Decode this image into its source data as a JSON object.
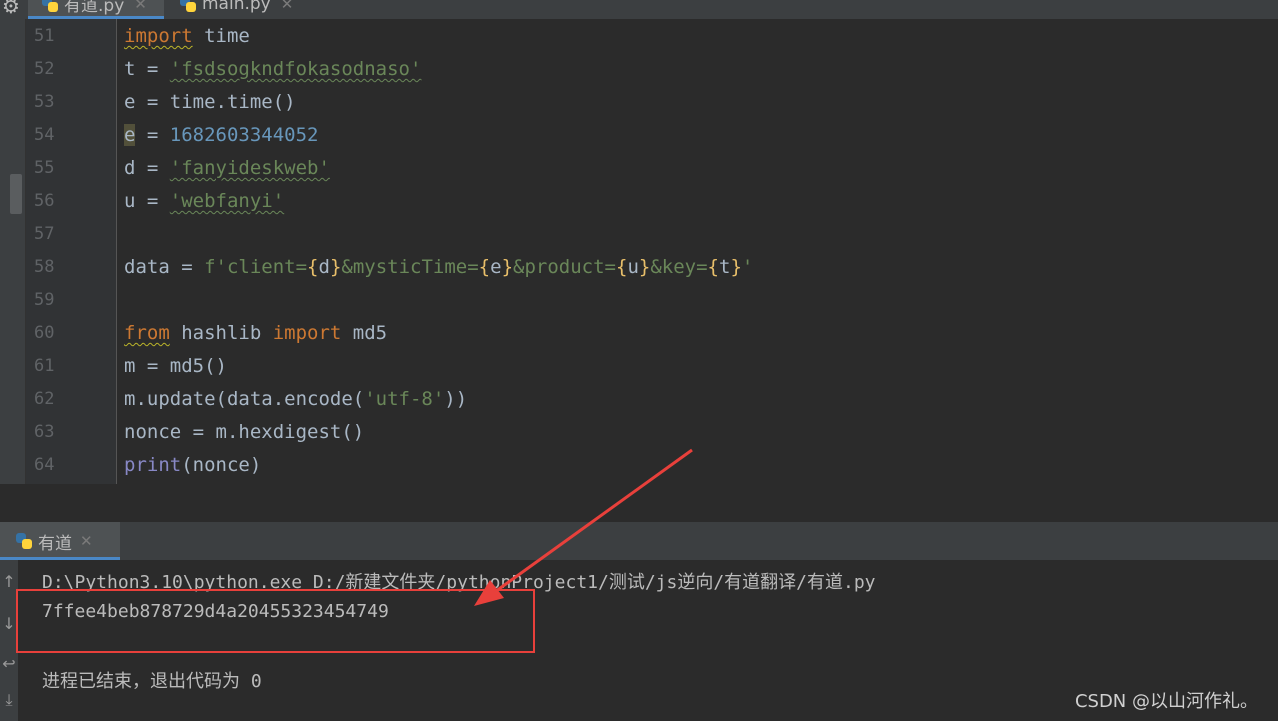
{
  "tabs": [
    {
      "label": "有道.py",
      "active": true
    },
    {
      "label": "main.py",
      "active": false
    }
  ],
  "editor": {
    "lines": [
      {
        "num": "51"
      },
      {
        "num": "52"
      },
      {
        "num": "53"
      },
      {
        "num": "54"
      },
      {
        "num": "55"
      },
      {
        "num": "56"
      },
      {
        "num": "57"
      },
      {
        "num": "58"
      },
      {
        "num": "59"
      },
      {
        "num": "60"
      },
      {
        "num": "61"
      },
      {
        "num": "62"
      },
      {
        "num": "63"
      },
      {
        "num": "64"
      }
    ],
    "code": {
      "l51_kw": "import",
      "l51_rest": " time",
      "l52_var": "t",
      "l52_eq": " = ",
      "l52_str": "'fsdsogkndfokasodnaso'",
      "l53_text": "e = time.time()",
      "l54_var": "e",
      "l54_eq": " = ",
      "l54_num": "1682603344052",
      "l55_var": "d",
      "l55_eq": " = ",
      "l55_str": "'fanyideskweb'",
      "l56_var": "u",
      "l56_eq": " = ",
      "l56_str": "'webfanyi'",
      "l58_a": "data = ",
      "l58_f": "f'client=",
      "l58_b1": "{",
      "l58_v1": "d",
      "l58_b2": "}",
      "l58_s2": "&mysticTime=",
      "l58_b3": "{",
      "l58_v2": "e",
      "l58_b4": "}",
      "l58_s3": "&product=",
      "l58_b5": "{",
      "l58_v3": "u",
      "l58_b6": "}",
      "l58_s4": "&key=",
      "l58_b7": "{",
      "l58_v4": "t",
      "l58_b8": "}",
      "l58_end": "'",
      "l60_kw1": "from",
      "l60_mid": " hashlib ",
      "l60_kw2": "import",
      "l60_rest": " md5",
      "l61_text": "m = md5()",
      "l62_a": "m.update(data.encode(",
      "l62_str": "'utf-8'",
      "l62_b": "))",
      "l63_text": "nonce = m.hexdigest()",
      "l64_fn": "print",
      "l64_rest": "(nonce)"
    }
  },
  "run": {
    "tab_label": "有道",
    "command": "D:\\Python3.10\\python.exe D:/新建文件夹/pythonProject1/测试/js逆向/有道翻译/有道.py",
    "output": "7ffee4beb878729d4a20455323454749",
    "exit_message": "进程已结束，退出代码为 0"
  },
  "watermark": "CSDN @以山河作礼。",
  "colors": {
    "annotation": "#e8403b",
    "keyword": "#cc7832",
    "string": "#6a8759",
    "number": "#6897bb"
  }
}
